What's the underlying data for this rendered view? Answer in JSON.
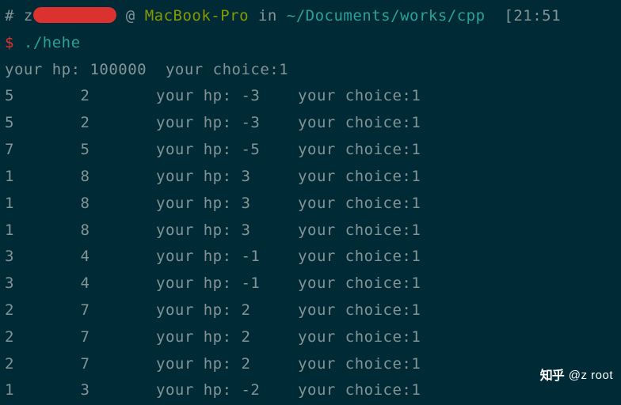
{
  "prompt": {
    "hash": "#",
    "user_prefix": "z",
    "at": " @ ",
    "host": "MacBook-Pro",
    "in": " in ",
    "path": "~/Documents/works/cpp",
    "time": "  [21:51"
  },
  "command": {
    "dollar": "$",
    "text": " ./hehe"
  },
  "first_output": "your hp: 100000  your choice:1",
  "rows": [
    {
      "a": "5",
      "b": "2",
      "hp": "-3",
      "choice": "1"
    },
    {
      "a": "5",
      "b": "2",
      "hp": "-3",
      "choice": "1"
    },
    {
      "a": "7",
      "b": "5",
      "hp": "-5",
      "choice": "1"
    },
    {
      "a": "1",
      "b": "8",
      "hp": "3",
      "choice": "1"
    },
    {
      "a": "1",
      "b": "8",
      "hp": "3",
      "choice": "1"
    },
    {
      "a": "1",
      "b": "8",
      "hp": "3",
      "choice": "1"
    },
    {
      "a": "3",
      "b": "4",
      "hp": "-1",
      "choice": "1"
    },
    {
      "a": "3",
      "b": "4",
      "hp": "-1",
      "choice": "1"
    },
    {
      "a": "2",
      "b": "7",
      "hp": "2",
      "choice": "1"
    },
    {
      "a": "2",
      "b": "7",
      "hp": "2",
      "choice": "1"
    },
    {
      "a": "2",
      "b": "7",
      "hp": "2",
      "choice": "1"
    },
    {
      "a": "1",
      "b": "3",
      "hp": "-2",
      "choice": "1"
    }
  ],
  "labels": {
    "your_hp": "your hp: ",
    "your_choice": "your choice:"
  },
  "watermark": {
    "icon": "知乎",
    "text": "@z root"
  }
}
